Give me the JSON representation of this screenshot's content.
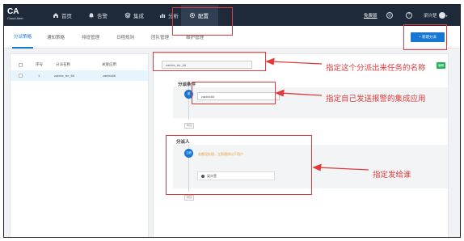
{
  "brand": {
    "name": "CA",
    "subtitle": "Cloud Alert"
  },
  "nav": {
    "items": [
      {
        "label": "首页",
        "icon": "home-icon"
      },
      {
        "label": "告警",
        "icon": "bell-icon"
      },
      {
        "label": "集成",
        "icon": "stack-icon"
      },
      {
        "label": "分析",
        "icon": "chart-icon"
      },
      {
        "label": "配置",
        "icon": "gear-icon",
        "active": true
      }
    ],
    "free_version": "免费版",
    "user_name": "梁许楚"
  },
  "subtabs": [
    {
      "label": "分派策略",
      "active": true
    },
    {
      "label": "通知策略"
    },
    {
      "label": "排班管理"
    },
    {
      "label": "日程规则"
    },
    {
      "label": "团队管理"
    },
    {
      "label": "维护管理"
    }
  ],
  "new_button": "+ 新建分派",
  "table": {
    "headers": [
      "序号",
      "分派名称",
      "关联应用"
    ],
    "rows": [
      {
        "index": "1",
        "name": "zabbix_ter_66",
        "app": "zabbix66"
      }
    ]
  },
  "editor": {
    "name_value": "zabbix_ter_66",
    "green_button": "编辑",
    "condition_title": "分派条件",
    "condition_step": "或",
    "condition_value": "zabbix66",
    "condition_add": "添加",
    "assignee_title": "分派人",
    "assignee_step": "立即",
    "assignee_hint": "若都没处理，立即通知以下用户",
    "assignee_user": "梁许楚",
    "assignee_add": "添加"
  },
  "annotations": [
    "指定这个分派出来任务的名称",
    "指定自己发送报警的集成应用",
    "指定发给谁"
  ],
  "colors": {
    "nav_bg": "#1e2a3a",
    "accent": "#1677d2",
    "annotation": "#e23a3a",
    "green": "#23b357"
  }
}
